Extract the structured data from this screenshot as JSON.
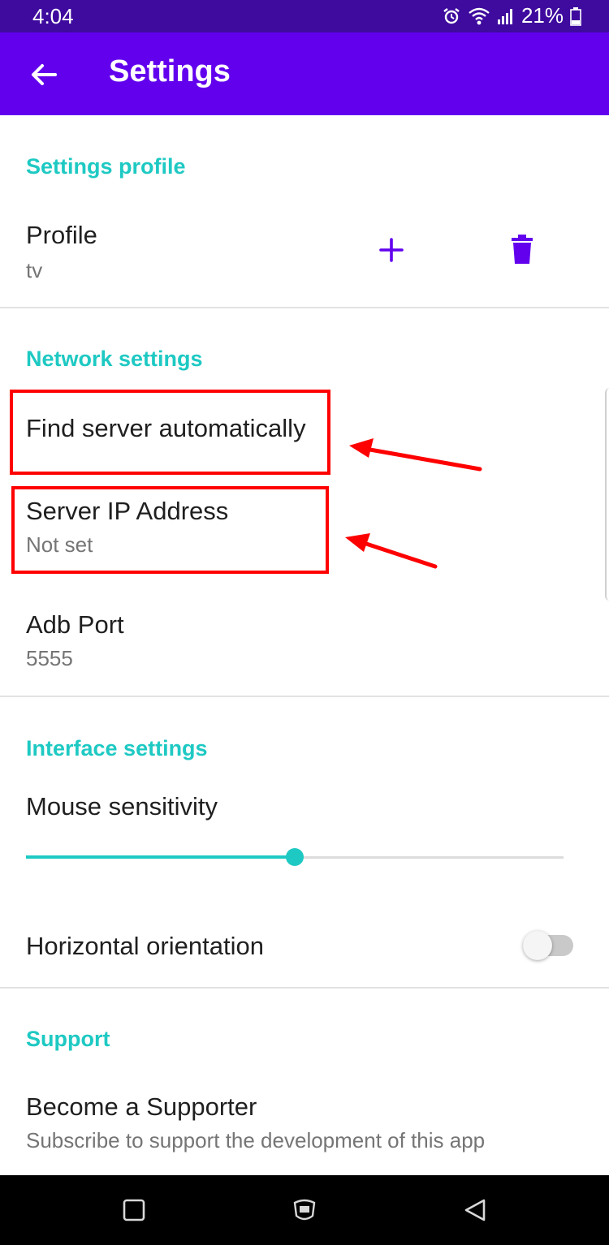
{
  "status_bar": {
    "time": "4:04",
    "battery": "21%"
  },
  "app_bar": {
    "title": "Settings",
    "back_icon": "arrow-left-icon"
  },
  "sections": {
    "profile": {
      "header": "Settings profile",
      "title": "Profile",
      "value": "tv",
      "add_icon": "plus-icon",
      "delete_icon": "trash-icon"
    },
    "network": {
      "header": "Network settings",
      "find_server": "Find server automatically",
      "server_ip_title": "Server IP Address",
      "server_ip_value": "Not set",
      "adb_port_title": "Adb Port",
      "adb_port_value": "5555"
    },
    "interface": {
      "header": "Interface settings",
      "mouse_sensitivity": "Mouse sensitivity",
      "mouse_sensitivity_level": 0.5,
      "horizontal_orientation": "Horizontal orientation",
      "horizontal_orientation_on": false
    },
    "support": {
      "header": "Support",
      "title": "Become a Supporter",
      "subtitle": "Subscribe to support the development of this app"
    }
  },
  "colors": {
    "status_bar": "#3e0b9e",
    "app_bar": "#6200ee",
    "accent": "#1ec9c3",
    "annotation": "#ff0000"
  },
  "nav_bar": {
    "icons": [
      "recents-icon",
      "home-icon",
      "back-triangle-icon"
    ]
  }
}
